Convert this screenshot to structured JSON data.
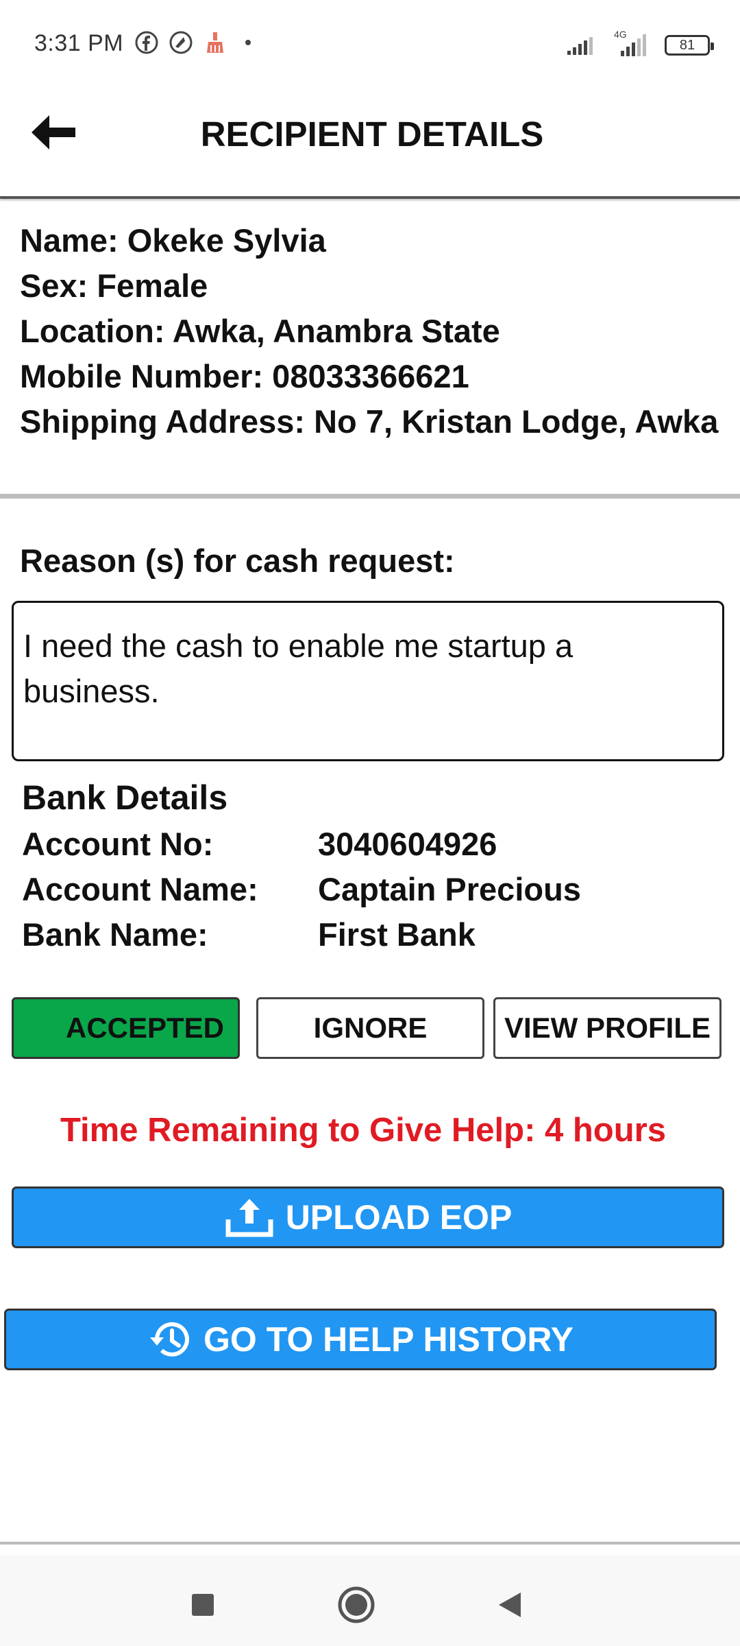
{
  "status_bar": {
    "time": "3:31 PM",
    "network_label": "4G",
    "battery": "81"
  },
  "header": {
    "title": "RECIPIENT DETAILS",
    "back_icon": "arrow-left-icon"
  },
  "recipient": {
    "name_line": "Name: Okeke Sylvia",
    "sex_line": "Sex: Female",
    "location_line": "Location: Awka, Anambra State",
    "mobile_line": "Mobile Number: 08033366621",
    "address_line": "Shipping Address: No 7, Kristan Lodge, Awka"
  },
  "reason": {
    "label": "Reason (s) for cash request:",
    "text": "I need the cash to enable me startup a business."
  },
  "bank": {
    "title": "Bank Details",
    "rows": [
      {
        "key": "Account No:",
        "value": "3040604926"
      },
      {
        "key": "Account Name:",
        "value": "Captain Precious"
      },
      {
        "key": "Bank Name:",
        "value": "First Bank"
      }
    ]
  },
  "actions": {
    "accepted_label": "ACCEPTED",
    "ignore_label": "IGNORE",
    "view_profile_label": "VIEW PROFILE"
  },
  "time_remaining": "Time Remaining to Give Help: 4 hours",
  "upload": {
    "label": "UPLOAD EOP",
    "icon": "upload-icon"
  },
  "history": {
    "label": "GO TO HELP HISTORY",
    "icon": "history-icon"
  },
  "colors": {
    "accepted": "#0aa64a",
    "primary_button": "#2196f3",
    "alert_text": "#e01b24"
  }
}
